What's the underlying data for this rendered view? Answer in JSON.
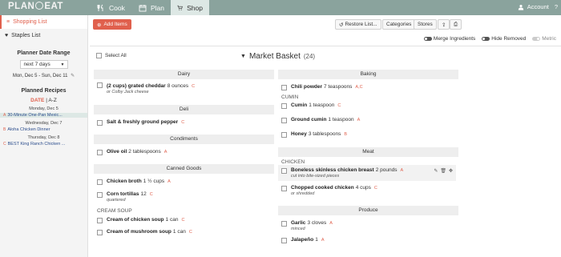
{
  "app": {
    "logo_left": "PLAN",
    "logo_right": "EAT"
  },
  "nav": {
    "cook": "Cook",
    "plan": "Plan",
    "shop": "Shop"
  },
  "account": {
    "label": "Account",
    "help": "?"
  },
  "sidebar": {
    "shopping_list": "Shopping List",
    "staples_list": "Staples List",
    "planner_title": "Planner Date Range",
    "range_select": "next 7 days",
    "date_range": "Mon, Dec 5  -  Sun, Dec 11",
    "planned_title": "Planned Recipes",
    "sort_date": "DATE",
    "sort_sep": "|",
    "sort_az": "A-Z",
    "days": [
      {
        "label": "Monday, Dec 5",
        "recipes": [
          "30-Minute One-Pan Mexic..."
        ]
      },
      {
        "label": "Wednesday, Dec 7",
        "recipes": [
          "Aloha Chicken Dinner"
        ]
      },
      {
        "label": "Thursday, Dec 8",
        "recipes": [
          "BEST King Ranch Chicken ..."
        ]
      }
    ]
  },
  "toolbar": {
    "add_items": "Add Items",
    "restore": "Restore List...",
    "categories": "Categories",
    "stores": "Stores"
  },
  "options": {
    "merge": "Merge Ingredients",
    "hide_removed": "Hide Removed",
    "metric": "Metric"
  },
  "list": {
    "select_all": "Select All",
    "title": "Market Basket",
    "count": "(24)"
  },
  "left_col": {
    "dairy": {
      "title": "Dairy",
      "items": [
        {
          "name": "(2 cups) grated cheddar",
          "qty": "8 ounces",
          "mark": "C",
          "note": "or Colby Jack cheese"
        }
      ]
    },
    "deli": {
      "title": "Deli",
      "items": [
        {
          "name": "Salt & freshly ground pepper",
          "qty": "",
          "mark": "C",
          "note": ""
        }
      ]
    },
    "condiments": {
      "title": "Condiments",
      "items": [
        {
          "name": "Olive oil",
          "qty": "2 tablespoons",
          "mark": "A",
          "note": ""
        }
      ]
    },
    "canned": {
      "title": "Canned Goods",
      "items": [
        {
          "name": "Chicken broth",
          "qty": "1 ½ cups",
          "mark": "A",
          "note": ""
        },
        {
          "name": "Corn tortillas",
          "qty": "12",
          "mark": "C",
          "note": "quartered"
        }
      ]
    },
    "cream_soup": {
      "title": "CREAM SOUP",
      "items": [
        {
          "name": "Cream of chicken soup",
          "qty": "1 can",
          "mark": "C",
          "note": ""
        },
        {
          "name": "Cream of mushroom soup",
          "qty": "1 can",
          "mark": "C",
          "note": ""
        }
      ]
    }
  },
  "right_col": {
    "baking": {
      "title": "Baking",
      "items": [
        {
          "name": "Chili powder",
          "qty": "7 teaspoons",
          "mark": "A,C",
          "note": ""
        }
      ]
    },
    "cumin": {
      "title": "CUMIN",
      "items": [
        {
          "name": "Cumin",
          "qty": "1 teaspoon",
          "mark": "C",
          "note": ""
        },
        {
          "name": "Ground cumin",
          "qty": "1 teaspoon",
          "mark": "A",
          "note": ""
        }
      ]
    },
    "honey": {
      "items": [
        {
          "name": "Honey",
          "qty": "3 tablespoons",
          "mark": "B",
          "note": ""
        }
      ]
    },
    "meat": {
      "title": "Meat",
      "items": []
    },
    "chicken": {
      "title": "CHICKEN",
      "items": [
        {
          "name": "Boneless skinless chicken breast",
          "qty": "2 pounds",
          "mark": "A",
          "note": "cut into bite-sized pieces"
        },
        {
          "name": "Chopped cooked chicken",
          "qty": "4 cups",
          "mark": "C",
          "note": "or shredded"
        }
      ]
    },
    "produce": {
      "title": "Produce",
      "items": [
        {
          "name": "Garlic",
          "qty": "3 cloves",
          "mark": "A",
          "note": "minced"
        },
        {
          "name": "Jalapeño",
          "qty": "1",
          "mark": "A",
          "note": ""
        }
      ]
    }
  }
}
